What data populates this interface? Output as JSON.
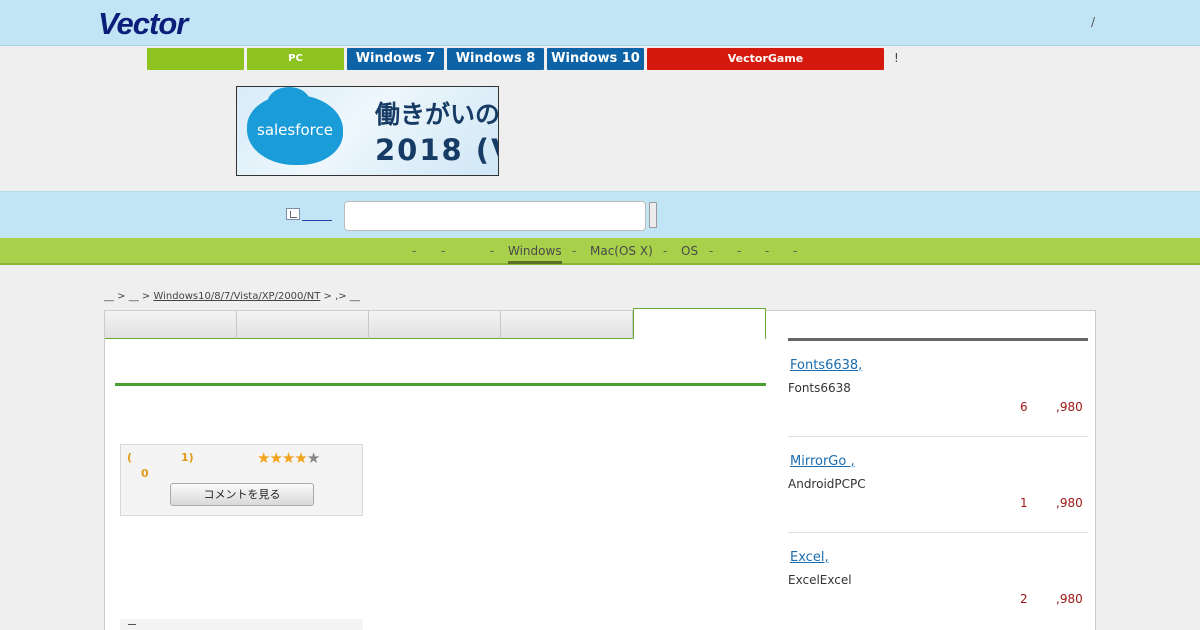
{
  "header": {
    "logo": "Vector",
    "slash": "/"
  },
  "nav": {
    "buttons": [
      {
        "label": "",
        "color": "#8ec21f"
      },
      {
        "label": "PC",
        "color": "#8ec21f"
      },
      {
        "label": "Windows 7",
        "color": "#0d63a5"
      },
      {
        "label": "Windows 8",
        "color": "#0d63a5"
      },
      {
        "label": "Windows 10",
        "color": "#0d63a5"
      },
      {
        "label": "VectorGame",
        "color": "#d5190c"
      }
    ],
    "bang": "!"
  },
  "banner": {
    "brand": "salesforce",
    "line1": "働きがいの",
    "line2": "2018 (V"
  },
  "search": {
    "value": ""
  },
  "category_nav": {
    "dashes": [
      "-",
      "-",
      "-",
      "-",
      "-",
      "-",
      "-",
      "-",
      "-"
    ],
    "windows": "Windows",
    "mac": "Mac(OS X)",
    "os": "OS"
  },
  "breadcrumb": {
    "part1": "__ > __ > ",
    "os_link": "Windows10/8/7/Vista/XP/2000/NT",
    "part2": " > ,> __"
  },
  "rating": {
    "paren_open": "(",
    "count": "1)",
    "zero": "0",
    "stars": {
      "filled": 4,
      "total": 5
    },
    "comment_button": "コメントを見る"
  },
  "sidebar": {
    "items": [
      {
        "link": "Fonts6638",
        "comma": ",",
        "desc": "Fonts6638",
        "num": "6",
        "price": ",980"
      },
      {
        "link": "MirrorGo ",
        "comma": ",",
        "desc": "AndroidPCPC",
        "num": "1",
        "price": ",980"
      },
      {
        "link": "Excel",
        "comma": ",",
        "desc": "ExcelExcel",
        "num": "2",
        "price": ",980"
      }
    ]
  },
  "colors": {
    "header_bg": "#c2e5f6",
    "green_bar": "#a8d04a",
    "accent_green": "#4a9f2f",
    "price_red": "#a01818"
  }
}
